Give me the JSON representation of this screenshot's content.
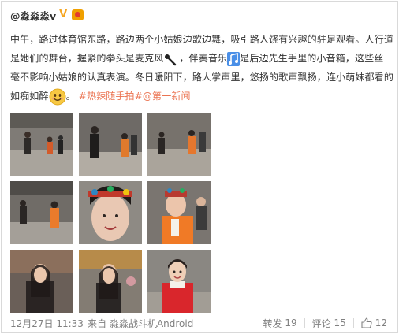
{
  "post": {
    "username": "@淼淼淼v",
    "verified_icon": "verified-v-icon",
    "medal_icon": "member-medal-icon",
    "text_lines": [
      "中午，路过体育馆东路，路边两个小姑娘边歌边舞，吸引路人饶有兴趣的驻足观看。人行道",
      "是她们的舞台，握紧的拳头是麦克风",
      "，伴奏音乐",
      "是后边先生手里的小音箱，这些丝",
      "毫不影响小姑娘的认真表演。冬日暖阳下，路人掌声里，悠扬的歌声飘扬，连小萌妹都看的",
      "如痴如醉",
      "。"
    ],
    "topics": [
      "#热辣随手拍#",
      "@第一新闻"
    ],
    "emoji": [
      "microphone-icon",
      "music-note-icon",
      "smile-emoji-icon"
    ]
  },
  "footer": {
    "time": "12月27日 11:33",
    "from_label": "来自",
    "source": "淼淼战斗机Android",
    "repost_label": "转发",
    "repost_count": "19",
    "comment_label": "评论",
    "comment_count": "15",
    "like_count": "12",
    "like_icon": "thumbs-up-icon"
  }
}
